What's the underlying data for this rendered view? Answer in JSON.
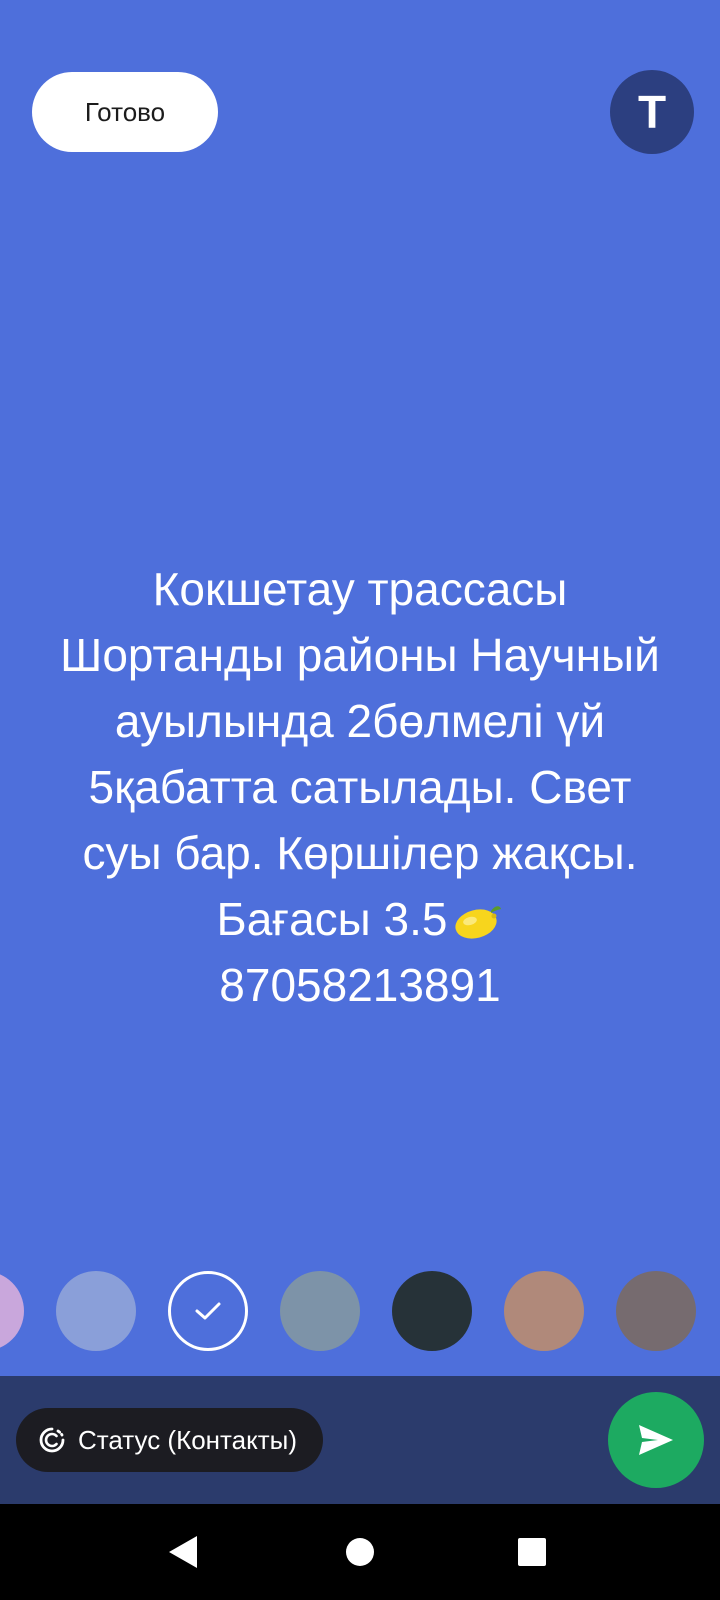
{
  "toolbar": {
    "done_label": "Готово",
    "text_tool_label": "T"
  },
  "status": {
    "lines": [
      "Кокшетау трассасы",
      "Шортанды районы Научный",
      "ауылында 2бөлмелі үй",
      "5қабатта сатылады. Свет",
      "суы бар. Көршілер жақсы.",
      "Бағасы 3.5",
      "87058213891"
    ],
    "emoji": "lemon",
    "background_color": "#4e6fdb"
  },
  "palette": {
    "colors": [
      "#c9a7dc",
      "#8a9fd9",
      "#4e6fdb",
      "#7d93a8",
      "#263238",
      "#b0897a",
      "#766b6f"
    ],
    "selected_index": 2
  },
  "composer": {
    "privacy_label": "Статус (Контакты)",
    "send_icon": "send-icon"
  },
  "navigation": {
    "buttons": [
      "back-icon",
      "home-icon",
      "recents-icon"
    ]
  },
  "colors": {
    "bottom_bar": "#2b3b6c",
    "send_button": "#1daa61",
    "text_tool_button": "#2c3f80"
  }
}
